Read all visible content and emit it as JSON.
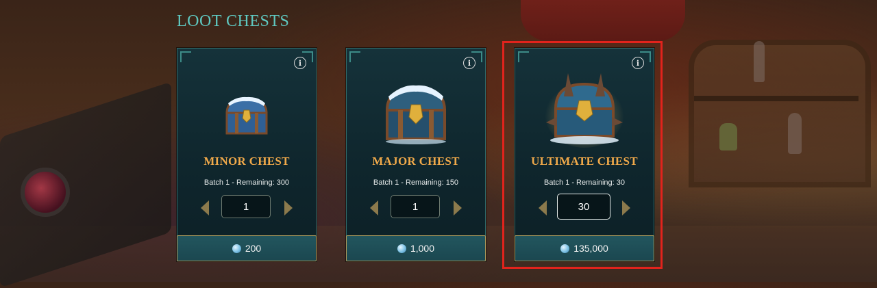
{
  "header": {
    "title": "LOOT CHESTS"
  },
  "cards": [
    {
      "name": "MINOR CHEST",
      "batch": "Batch 1 - Remaining: 300",
      "quantity": "1",
      "price": "200",
      "icons": {
        "info": "info-icon",
        "currency": "gem-icon"
      }
    },
    {
      "name": "MAJOR CHEST",
      "batch": "Batch 1 - Remaining: 150",
      "quantity": "1",
      "price": "1,000",
      "icons": {
        "info": "info-icon",
        "currency": "gem-icon"
      }
    },
    {
      "name": "ULTIMATE CHEST",
      "batch": "Batch 1 - Remaining: 30",
      "quantity": "30",
      "price": "135,000",
      "icons": {
        "info": "info-icon",
        "currency": "gem-icon"
      }
    }
  ],
  "info_glyph": "i",
  "colors": {
    "title": "#5fc8c0",
    "chest_name": "#f0a94a",
    "highlight": "#e2231c",
    "button_border": "#b19d5c"
  }
}
